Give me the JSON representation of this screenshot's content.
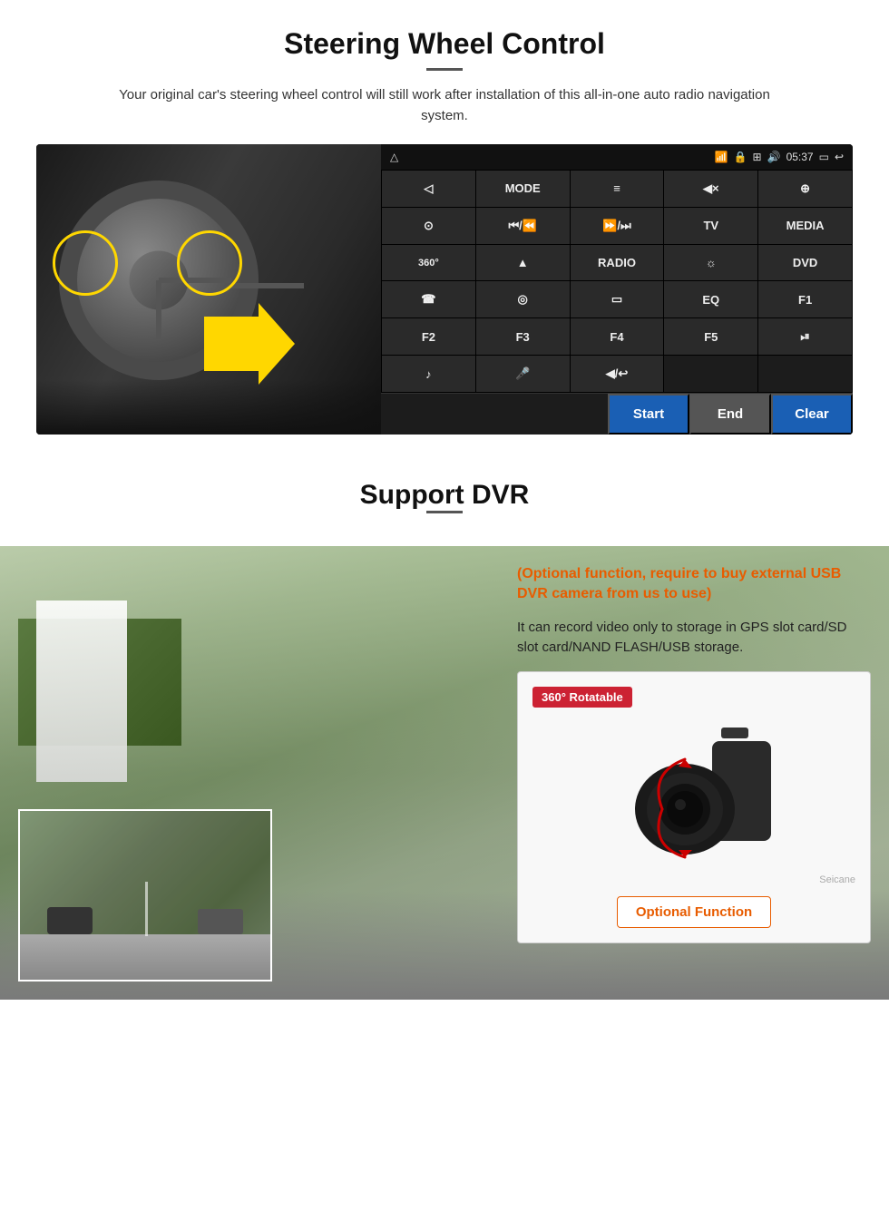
{
  "steering": {
    "title": "Steering Wheel Control",
    "description": "Your original car's steering wheel control will still work after installation of this all-in-one auto radio navigation system.",
    "status_bar": {
      "time": "05:37",
      "icons": [
        "wifi",
        "lock",
        "signal",
        "sound",
        "window",
        "back"
      ]
    },
    "buttons": [
      {
        "label": "◁",
        "row": 1,
        "col": 1
      },
      {
        "label": "MODE",
        "row": 1,
        "col": 2
      },
      {
        "label": "≡",
        "row": 1,
        "col": 3
      },
      {
        "label": "◀×",
        "row": 1,
        "col": 4
      },
      {
        "label": "⊕",
        "row": 1,
        "col": 5
      },
      {
        "label": "⊙",
        "row": 2,
        "col": 1
      },
      {
        "label": "⏮",
        "row": 2,
        "col": 2
      },
      {
        "label": "⏭",
        "row": 2,
        "col": 3
      },
      {
        "label": "TV",
        "row": 2,
        "col": 4
      },
      {
        "label": "MEDIA",
        "row": 2,
        "col": 5
      },
      {
        "label": "360",
        "row": 3,
        "col": 1
      },
      {
        "label": "▲",
        "row": 3,
        "col": 2
      },
      {
        "label": "RADIO",
        "row": 3,
        "col": 3
      },
      {
        "label": "☀",
        "row": 3,
        "col": 4
      },
      {
        "label": "DVD",
        "row": 3,
        "col": 5
      },
      {
        "label": "☎",
        "row": 4,
        "col": 1
      },
      {
        "label": "◎",
        "row": 4,
        "col": 2
      },
      {
        "label": "▭",
        "row": 4,
        "col": 3
      },
      {
        "label": "EQ",
        "row": 4,
        "col": 4
      },
      {
        "label": "F1",
        "row": 4,
        "col": 5
      },
      {
        "label": "F2",
        "row": 5,
        "col": 1
      },
      {
        "label": "F3",
        "row": 5,
        "col": 2
      },
      {
        "label": "F4",
        "row": 5,
        "col": 3
      },
      {
        "label": "F5",
        "row": 5,
        "col": 4
      },
      {
        "label": "⏯",
        "row": 5,
        "col": 5
      },
      {
        "label": "♪",
        "row": 6,
        "col": 1
      },
      {
        "label": "🎤",
        "row": 6,
        "col": 2
      },
      {
        "label": "◀/↩",
        "row": 6,
        "col": 3
      }
    ],
    "action_buttons": {
      "start": "Start",
      "end": "End",
      "clear": "Clear"
    }
  },
  "dvr": {
    "title": "Support DVR",
    "optional_text": "(Optional function, require to buy external USB DVR camera from us to use)",
    "description": "It can record video only to storage in GPS slot card/SD slot card/NAND FLASH/USB storage.",
    "badge_360": "360° Rotatable",
    "optional_fn_label": "Optional Function",
    "watermark": "Seicane"
  }
}
